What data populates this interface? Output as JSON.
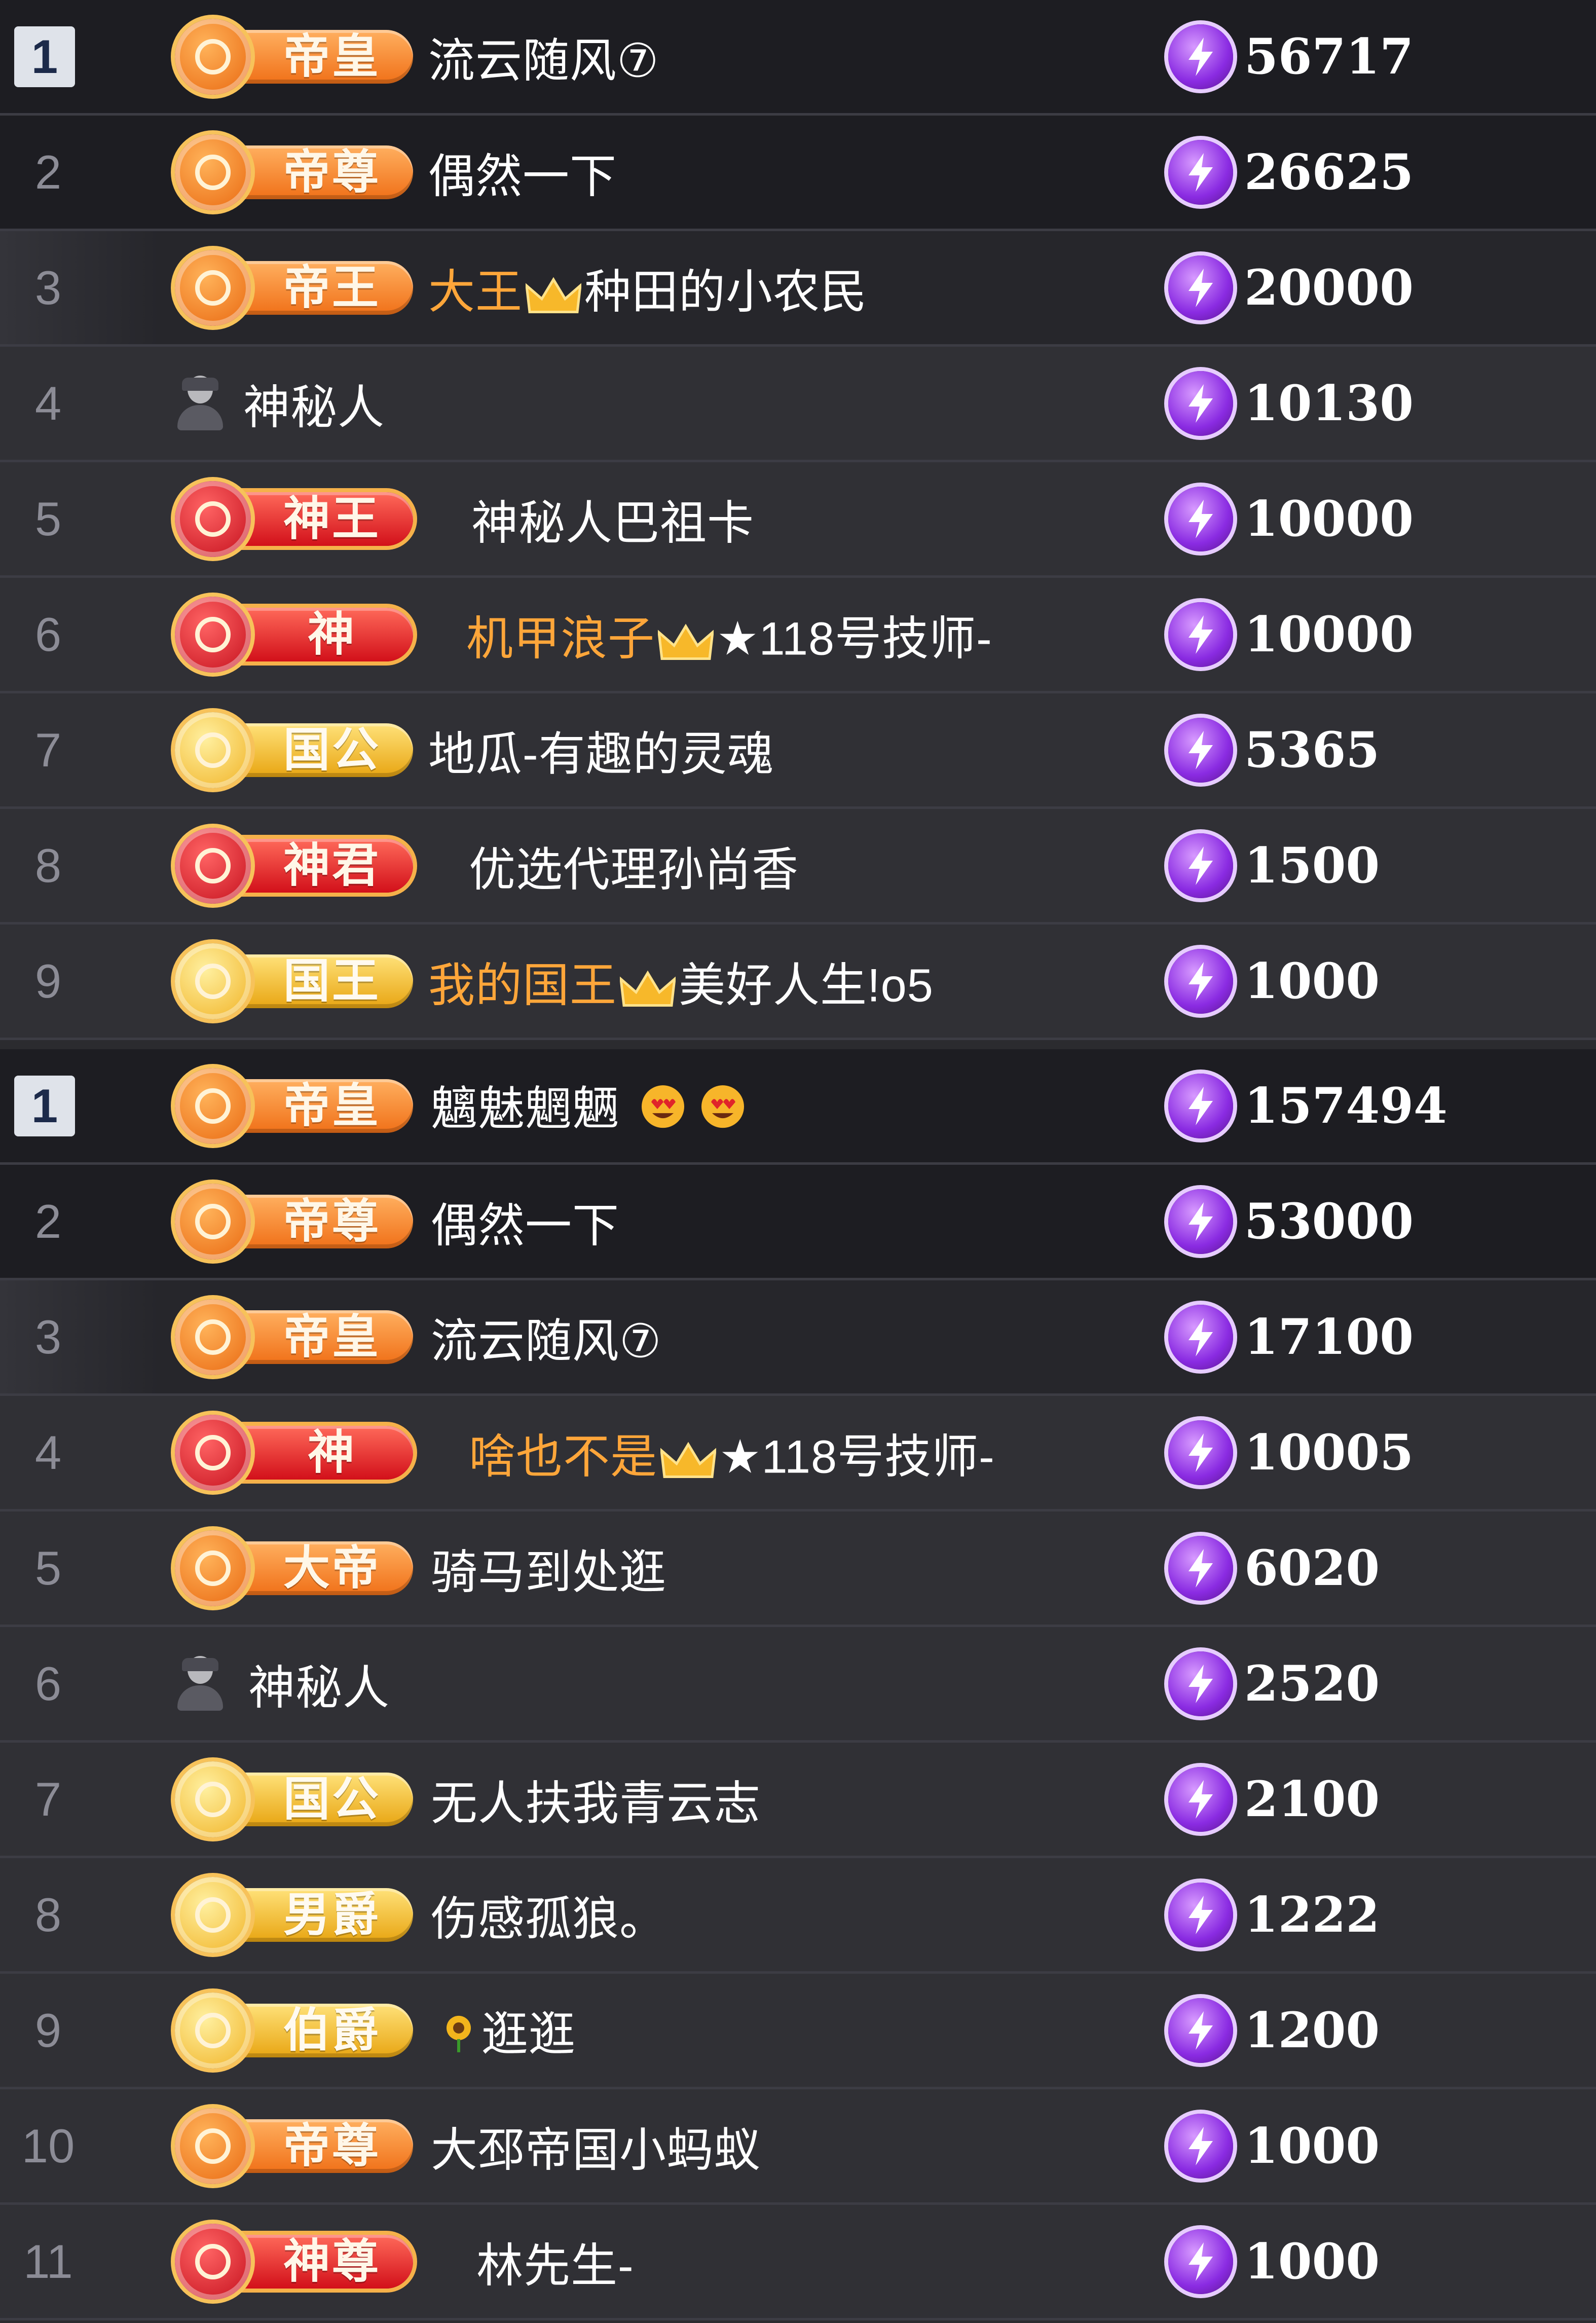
{
  "colors": {
    "row_dark": "#1d1d22",
    "row_mid": "#303035",
    "rank_text": "#8c8c96",
    "name_highlight": "#ffa63a",
    "gem": "#8a2be2"
  },
  "panels": [
    {
      "rows": [
        {
          "rank": "1",
          "tier": "帝皇",
          "badge_color": "orange",
          "name": "流云随风⑦",
          "score": "56717"
        },
        {
          "rank": "2",
          "tier": "帝尊",
          "badge_color": "orange",
          "name": "偶然一下",
          "score": "26625"
        },
        {
          "rank": "3",
          "tier": "帝王",
          "badge_color": "orange",
          "name_hi": "大王",
          "name": "种田的小农民",
          "score": "20000"
        },
        {
          "rank": "4",
          "tier": "",
          "name": "神秘人",
          "score": "10130"
        },
        {
          "rank": "5",
          "tier": "神王",
          "badge_color": "red",
          "name": "神秘人巴祖卡",
          "score": "10000"
        },
        {
          "rank": "6",
          "tier": "神",
          "badge_color": "red",
          "name_hi": "机甲浪子",
          "name": "★118号技师-",
          "score": "10000"
        },
        {
          "rank": "7",
          "tier": "国公",
          "badge_color": "gold",
          "name": "地瓜-有趣的灵魂",
          "score": "5365"
        },
        {
          "rank": "8",
          "tier": "神君",
          "badge_color": "red",
          "name": "优选代理孙尚香",
          "score": "1500"
        },
        {
          "rank": "9",
          "tier": "国王",
          "badge_color": "gold",
          "name_hi": "我的国王",
          "name": "美好人生!o5",
          "score": "1000"
        }
      ]
    },
    {
      "rows": [
        {
          "rank": "1",
          "tier": "帝皇",
          "badge_color": "orange",
          "name": "魑魅魍魉",
          "score": "157494"
        },
        {
          "rank": "2",
          "tier": "帝尊",
          "badge_color": "orange",
          "name": "偶然一下",
          "score": "53000"
        },
        {
          "rank": "3",
          "tier": "帝皇",
          "badge_color": "orange",
          "name": "流云随风⑦",
          "score": "17100"
        },
        {
          "rank": "4",
          "tier": "神",
          "badge_color": "red",
          "name_hi": "啥也不是",
          "name": "★118号技师-",
          "score": "10005"
        },
        {
          "rank": "5",
          "tier": "大帝",
          "badge_color": "orange",
          "name": "骑马到处逛",
          "score": "6020"
        },
        {
          "rank": "6",
          "tier": "",
          "name": "神秘人",
          "score": "2520"
        },
        {
          "rank": "7",
          "tier": "国公",
          "badge_color": "gold",
          "name": "无人扶我青云志",
          "score": "2100"
        },
        {
          "rank": "8",
          "tier": "男爵",
          "badge_color": "gold",
          "name": "伤感孤狼。",
          "score": "1222"
        },
        {
          "rank": "9",
          "tier": "伯爵",
          "badge_color": "gold",
          "name": "逛逛",
          "score": "1200"
        },
        {
          "rank": "10",
          "tier": "帝尊",
          "badge_color": "orange",
          "name": "大邳帝国小蚂蚁",
          "score": "1000"
        },
        {
          "rank": "11",
          "tier": "神尊",
          "badge_color": "red",
          "name": "林先生-",
          "score": "1000"
        }
      ]
    }
  ]
}
